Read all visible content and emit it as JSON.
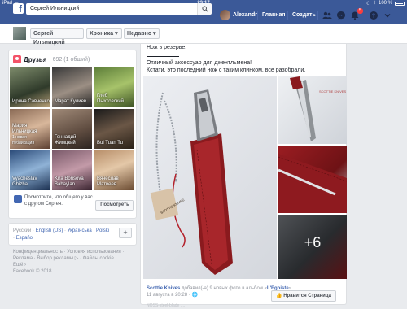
{
  "status": {
    "device": "iPad",
    "time": "23:17",
    "battery": "100 %"
  },
  "header": {
    "search_value": "Сергей Ильницкий",
    "user_name": "Alexandr",
    "nav_home": "Главная",
    "nav_create": "Создать",
    "notif_count": "5"
  },
  "profile_bar": {
    "name_button": "Сергей Ильницкий",
    "timeline_button": "Хроника",
    "recent_button": "Недавно"
  },
  "friends": {
    "title": "Друзья",
    "count": "· 692 (1 общий)",
    "items": [
      {
        "name": "Ирина Савченко",
        "sub": ""
      },
      {
        "name": "Марат Кулиев",
        "sub": ""
      },
      {
        "name": "Глеб Пыхтовский",
        "sub": ""
      },
      {
        "name": "Мария Ильницкая",
        "sub": "1 новая публикация"
      },
      {
        "name": "Геннадий Жимцкий",
        "sub": ""
      },
      {
        "name": "Bui Tuan Tu",
        "sub": ""
      },
      {
        "name": "Vyacheslav Ghizha",
        "sub": ""
      },
      {
        "name": "Kira Borisova Babaylan",
        "sub": ""
      },
      {
        "name": "Вячеслав Матвеев",
        "sub": ""
      }
    ],
    "suggest_text": "Посмотрите, что общего у вас с другом Сергея.",
    "see_button": "Посмотреть"
  },
  "languages": {
    "current": "Русский",
    "links": [
      "English (US)",
      "Українська",
      "Polski",
      "Español"
    ],
    "plus": "+"
  },
  "footer": {
    "line1": "Конфиденциальность · Условия использования ·",
    "line2": "Реклама · Выбор рекламы ▷ · Файлы cookie ·",
    "line3": "Ещё ›",
    "line4": "Facebook © 2018"
  },
  "post": {
    "line1": "Нож в резерве.",
    "separator": "_______",
    "line2": "Отличный аксессуар для джентльмена!",
    "line3": "Кстати, это последний нож с таким клинком, все разобрали.",
    "brand_tag": "SCOTTIE KNIVES",
    "more_photos": "+6",
    "author": "Scottie Knives",
    "added_text": "добавил(-а) 9 новых фото в альбом «",
    "album": "L'Egoiste",
    "album_end": "».",
    "date": "11 августа в 20:28 ·",
    "like_button": "Нравится Страница",
    "cut_text": "NOSS-steel-blade",
    "cut_text2": "...."
  }
}
